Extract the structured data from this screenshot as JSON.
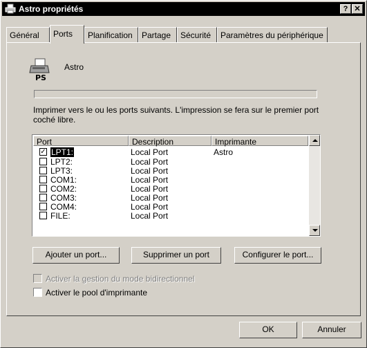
{
  "window": {
    "title": "Astro propriétés",
    "help_button": "?",
    "close_button": "✕"
  },
  "tabs": [
    {
      "label": "Général",
      "active": false
    },
    {
      "label": "Ports",
      "active": true
    },
    {
      "label": "Planification",
      "active": false
    },
    {
      "label": "Partage",
      "active": false
    },
    {
      "label": "Sécurité",
      "active": false
    },
    {
      "label": "Paramètres du périphérique",
      "active": false
    }
  ],
  "printer": {
    "name": "Astro",
    "icon": "printer-ps-icon"
  },
  "instructions": "Imprimer vers le ou les ports suivants. L'impression se fera sur le premier port coché libre.",
  "port_list": {
    "headers": {
      "port": "Port",
      "description": "Description",
      "printer": "Imprimante"
    },
    "rows": [
      {
        "port": "LPT1:",
        "description": "Local Port",
        "printer": "Astro",
        "checked": true,
        "selected": true
      },
      {
        "port": "LPT2:",
        "description": "Local Port",
        "printer": "",
        "checked": false,
        "selected": false
      },
      {
        "port": "LPT3:",
        "description": "Local Port",
        "printer": "",
        "checked": false,
        "selected": false
      },
      {
        "port": "COM1:",
        "description": "Local Port",
        "printer": "",
        "checked": false,
        "selected": false
      },
      {
        "port": "COM2:",
        "description": "Local Port",
        "printer": "",
        "checked": false,
        "selected": false
      },
      {
        "port": "COM3:",
        "description": "Local Port",
        "printer": "",
        "checked": false,
        "selected": false
      },
      {
        "port": "COM4:",
        "description": "Local Port",
        "printer": "",
        "checked": false,
        "selected": false
      },
      {
        "port": "FILE:",
        "description": "Local Port",
        "printer": "",
        "checked": false,
        "selected": false
      }
    ]
  },
  "buttons": {
    "add_port": "Ajouter un port...",
    "delete_port": "Supprimer un port",
    "configure_port": "Configurer le port...",
    "ok": "OK",
    "cancel": "Annuler"
  },
  "options": {
    "bidirectional": {
      "label": "Activer la gestion du mode bidirectionnel",
      "checked": false,
      "enabled": false
    },
    "pooling": {
      "label": "Activer le pool d'imprimante",
      "checked": false,
      "enabled": true
    }
  }
}
